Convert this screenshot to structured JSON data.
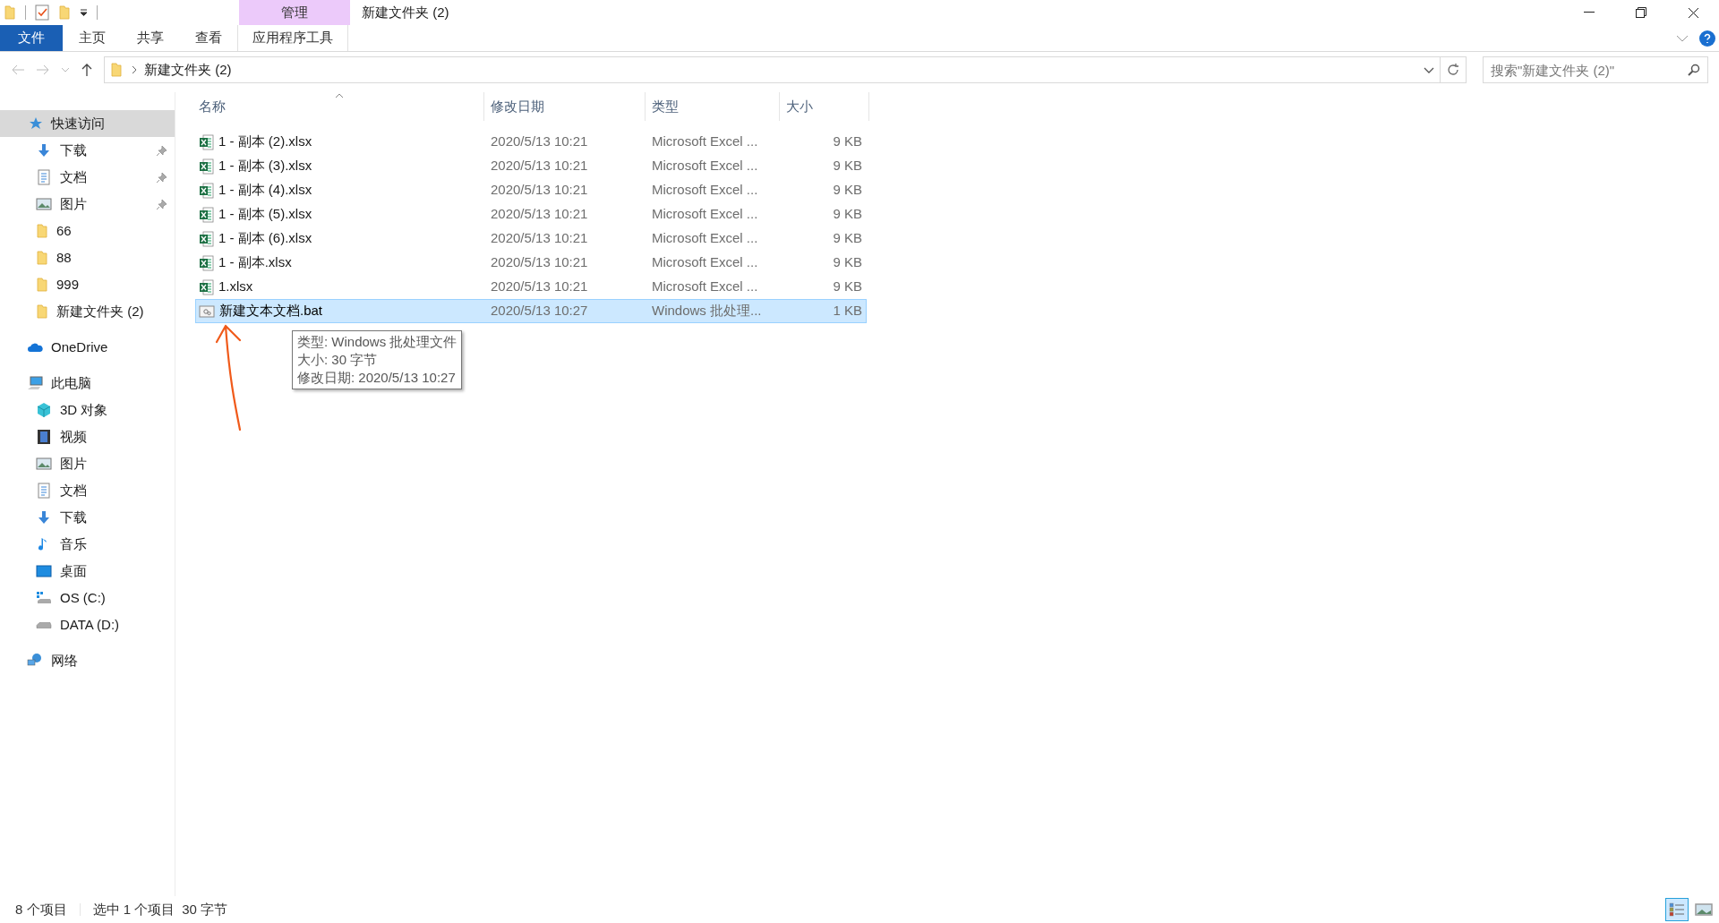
{
  "title_bar": {
    "context_group": "管理",
    "title": "新建文件夹 (2)"
  },
  "ribbon": {
    "tabs": [
      {
        "label": "文件",
        "kind": "file"
      },
      {
        "label": "主页",
        "kind": "normal"
      },
      {
        "label": "共享",
        "kind": "normal"
      },
      {
        "label": "查看",
        "kind": "normal"
      },
      {
        "label": "应用程序工具",
        "kind": "context"
      }
    ]
  },
  "address_bar": {
    "path": "新建文件夹 (2)"
  },
  "search": {
    "placeholder": "搜索\"新建文件夹 (2)\""
  },
  "sidebar": {
    "items": [
      {
        "label": "快速访问",
        "kind": "star",
        "selected": true,
        "children": [
          {
            "label": "下载",
            "kind": "download",
            "pinned": true
          },
          {
            "label": "文档",
            "kind": "document",
            "pinned": true
          },
          {
            "label": "图片",
            "kind": "picture",
            "pinned": true
          },
          {
            "label": "66",
            "kind": "folder",
            "pinned": false
          },
          {
            "label": "88",
            "kind": "folder",
            "pinned": false
          },
          {
            "label": "999",
            "kind": "folder",
            "pinned": false
          },
          {
            "label": "新建文件夹 (2)",
            "kind": "folder",
            "pinned": false
          }
        ]
      },
      {
        "label": "OneDrive",
        "kind": "cloud",
        "selected": false
      },
      {
        "label": "此电脑",
        "kind": "computer",
        "selected": false,
        "children": [
          {
            "label": "3D 对象",
            "kind": "cube",
            "pinned": false
          },
          {
            "label": "视频",
            "kind": "video",
            "pinned": false
          },
          {
            "label": "图片",
            "kind": "picture",
            "pinned": false
          },
          {
            "label": "文档",
            "kind": "document",
            "pinned": false
          },
          {
            "label": "下载",
            "kind": "download",
            "pinned": false
          },
          {
            "label": "音乐",
            "kind": "music",
            "pinned": false
          },
          {
            "label": "桌面",
            "kind": "desktop",
            "pinned": false
          },
          {
            "label": "OS (C:)",
            "kind": "os-drive",
            "pinned": false
          },
          {
            "label": "DATA (D:)",
            "kind": "drive",
            "pinned": false
          }
        ]
      },
      {
        "label": "网络",
        "kind": "network",
        "selected": false
      }
    ]
  },
  "file_list": {
    "columns": [
      {
        "label": "名称",
        "sorted": true
      },
      {
        "label": "修改日期",
        "sorted": false
      },
      {
        "label": "类型",
        "sorted": false
      },
      {
        "label": "大小",
        "sorted": false
      }
    ],
    "rows": [
      {
        "name": "1 - 副本 (2).xlsx",
        "date": "2020/5/13 10:21",
        "type": "Microsoft Excel ...",
        "size": "9 KB",
        "kind": "excel",
        "selected": false
      },
      {
        "name": "1 - 副本 (3).xlsx",
        "date": "2020/5/13 10:21",
        "type": "Microsoft Excel ...",
        "size": "9 KB",
        "kind": "excel",
        "selected": false
      },
      {
        "name": "1 - 副本 (4).xlsx",
        "date": "2020/5/13 10:21",
        "type": "Microsoft Excel ...",
        "size": "9 KB",
        "kind": "excel",
        "selected": false
      },
      {
        "name": "1 - 副本 (5).xlsx",
        "date": "2020/5/13 10:21",
        "type": "Microsoft Excel ...",
        "size": "9 KB",
        "kind": "excel",
        "selected": false
      },
      {
        "name": "1 - 副本 (6).xlsx",
        "date": "2020/5/13 10:21",
        "type": "Microsoft Excel ...",
        "size": "9 KB",
        "kind": "excel",
        "selected": false
      },
      {
        "name": "1 - 副本.xlsx",
        "date": "2020/5/13 10:21",
        "type": "Microsoft Excel ...",
        "size": "9 KB",
        "kind": "excel",
        "selected": false
      },
      {
        "name": "1.xlsx",
        "date": "2020/5/13 10:21",
        "type": "Microsoft Excel ...",
        "size": "9 KB",
        "kind": "excel",
        "selected": false
      },
      {
        "name": "新建文本文档.bat",
        "date": "2020/5/13 10:27",
        "type": "Windows 批处理...",
        "size": "1 KB",
        "kind": "batch",
        "selected": true
      }
    ]
  },
  "tooltip": {
    "lines": [
      "类型: Windows 批处理文件",
      "大小: 30 字节",
      "修改日期: 2020/5/13 10:27"
    ]
  },
  "status_bar": {
    "item_count": "8 个项目",
    "selection": "选中 1 个项目",
    "selection_size": "30 字节",
    "views": [
      {
        "kind": "details",
        "selected": true
      },
      {
        "kind": "thumbnails",
        "selected": false
      }
    ]
  }
}
